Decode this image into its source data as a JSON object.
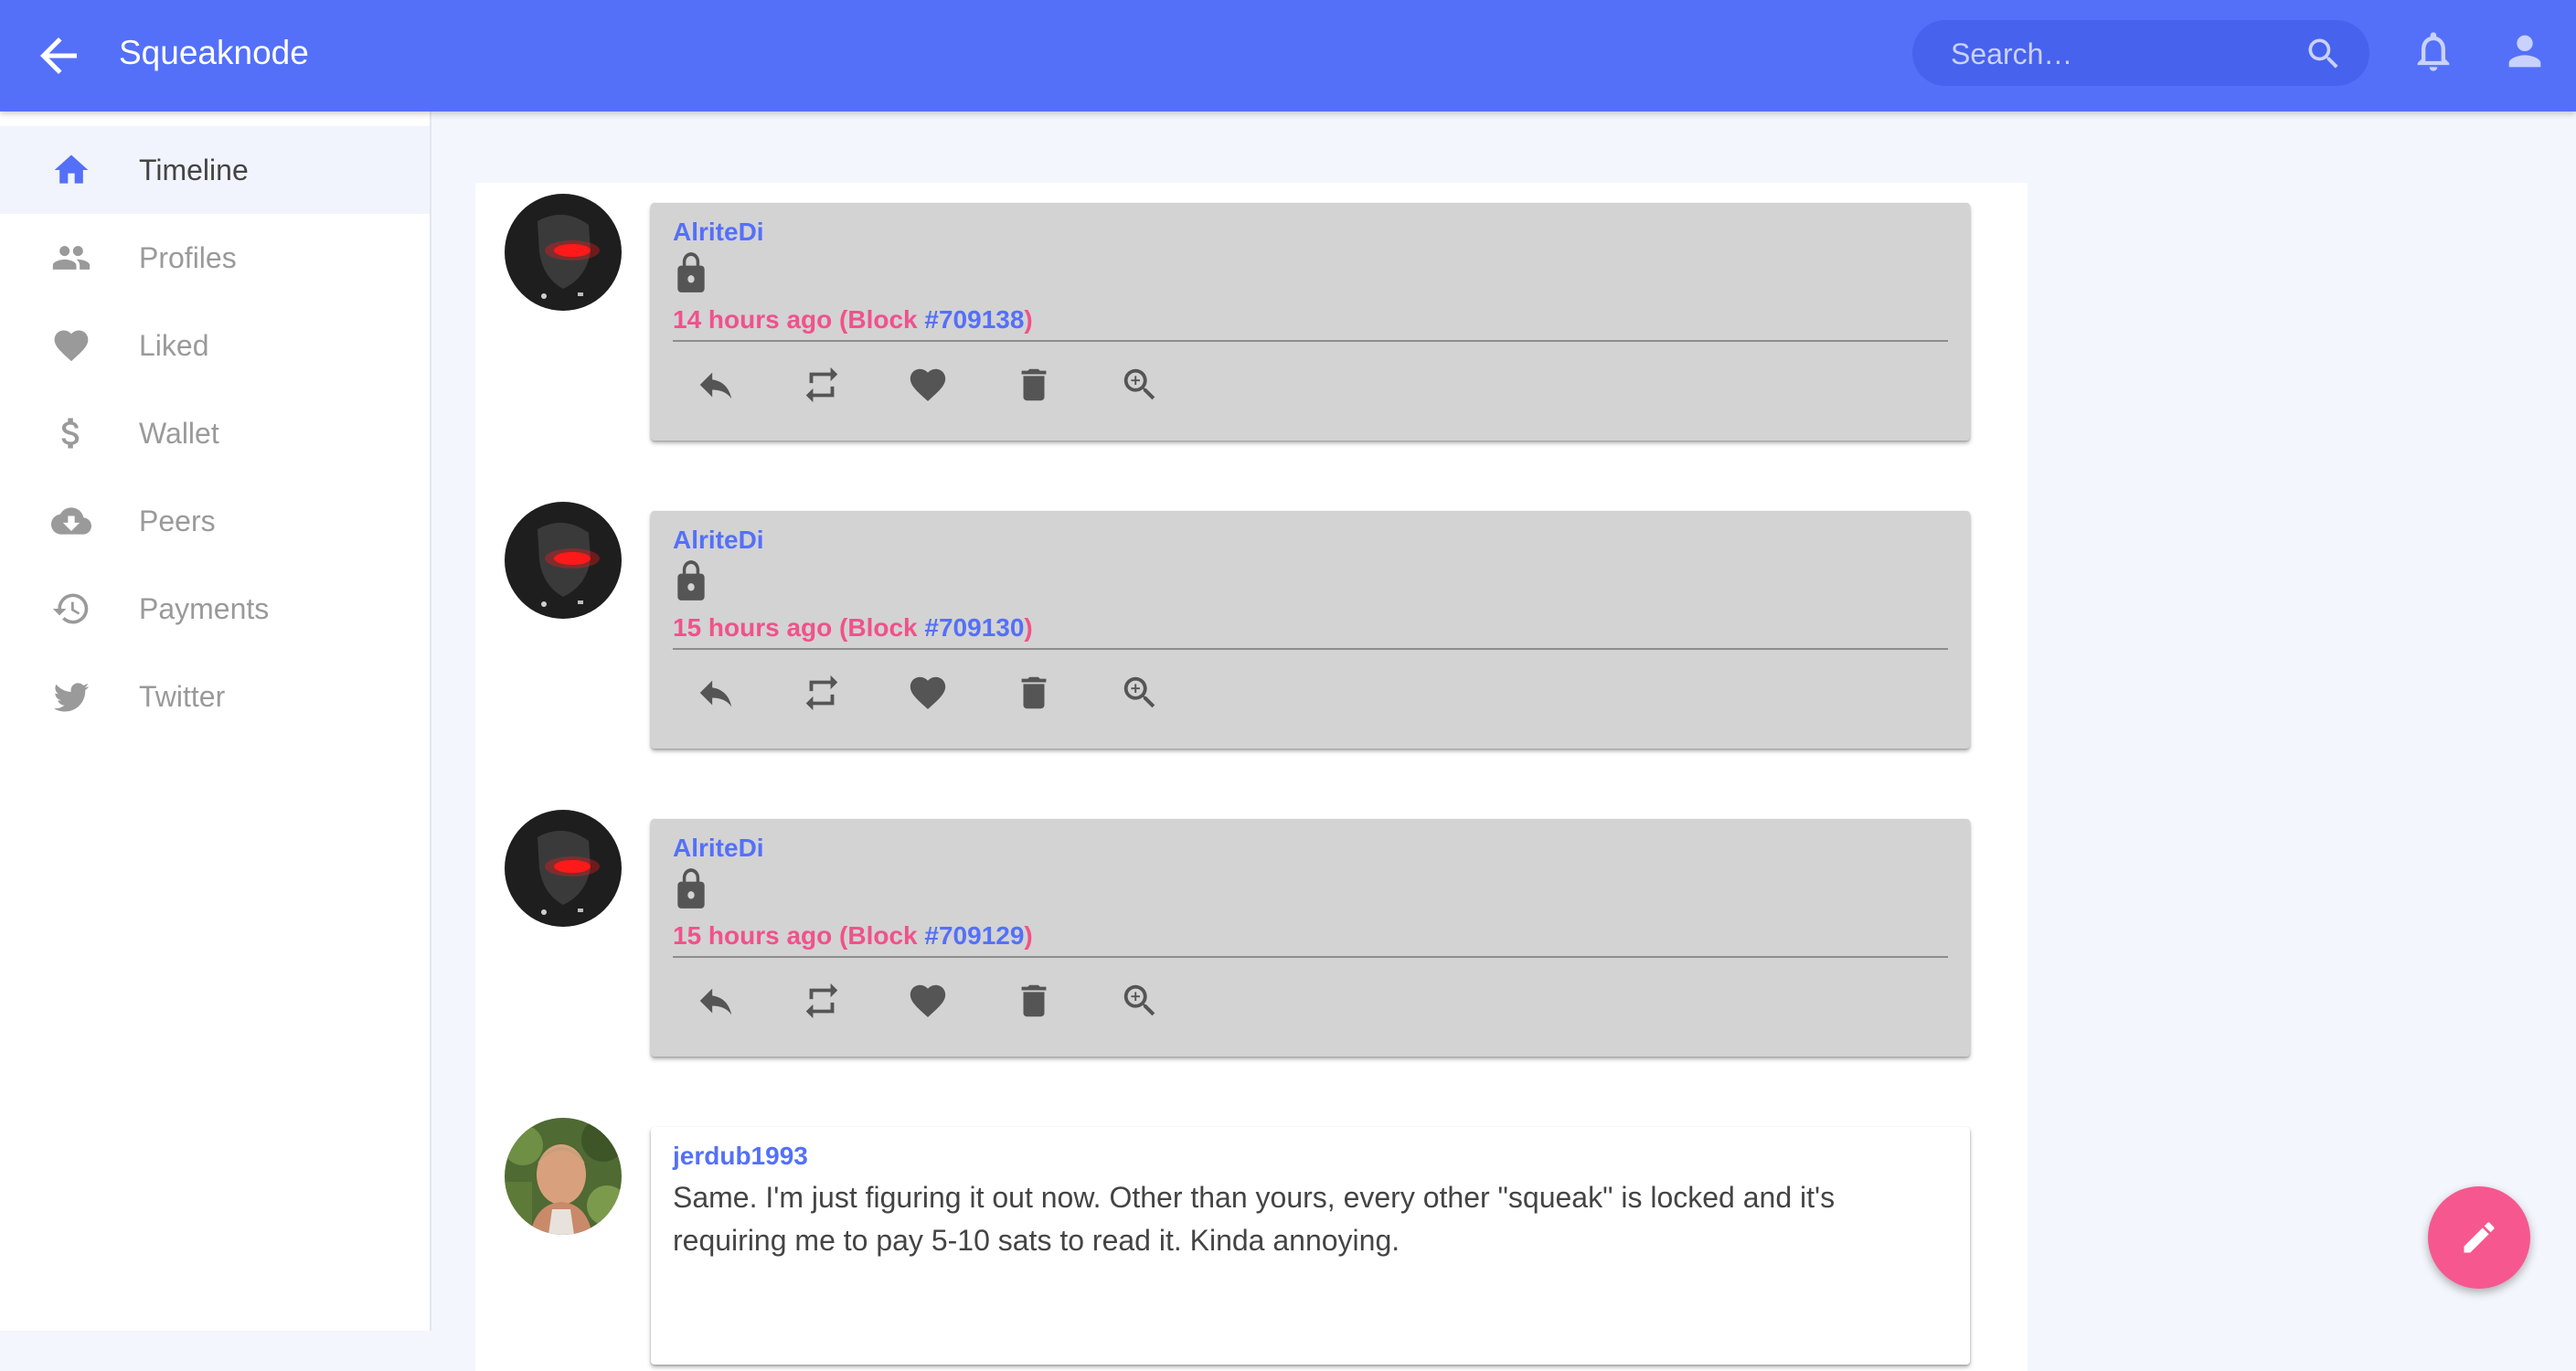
{
  "appbar": {
    "title": "Squeaknode",
    "search_placeholder": "Search…"
  },
  "sidebar": {
    "items": [
      {
        "label": "Timeline",
        "icon": "home-icon",
        "active": true
      },
      {
        "label": "Profiles",
        "icon": "people-icon",
        "active": false
      },
      {
        "label": "Liked",
        "icon": "heart-icon",
        "active": false
      },
      {
        "label": "Wallet",
        "icon": "dollar-icon",
        "active": false
      },
      {
        "label": "Peers",
        "icon": "cloud-download-icon",
        "active": false
      },
      {
        "label": "Payments",
        "icon": "history-icon",
        "active": false
      },
      {
        "label": "Twitter",
        "icon": "twitter-icon",
        "active": false
      }
    ]
  },
  "posts": [
    {
      "author": "AlriteDi",
      "locked": true,
      "time_prefix": "14 hours ago (Block ",
      "block": "#709138",
      "time_suffix": ")"
    },
    {
      "author": "AlriteDi",
      "locked": true,
      "time_prefix": "15 hours ago (Block ",
      "block": "#709130",
      "time_suffix": ")"
    },
    {
      "author": "AlriteDi",
      "locked": true,
      "time_prefix": "15 hours ago (Block ",
      "block": "#709129",
      "time_suffix": ")"
    },
    {
      "author": "jerdub1993",
      "locked": false,
      "text": "Same. I'm just figuring it out now. Other than yours, every other \"squeak\" is locked and it's requiring me to pay 5-10 sats to read it. Kinda annoying."
    }
  ],
  "actions": [
    "reply-icon",
    "resqueak-icon",
    "like-icon",
    "delete-icon",
    "zoom-in-icon"
  ],
  "colors": {
    "primary": "#5470f9",
    "accent": "#f0528a",
    "locked_card": "#d3d3d3"
  }
}
